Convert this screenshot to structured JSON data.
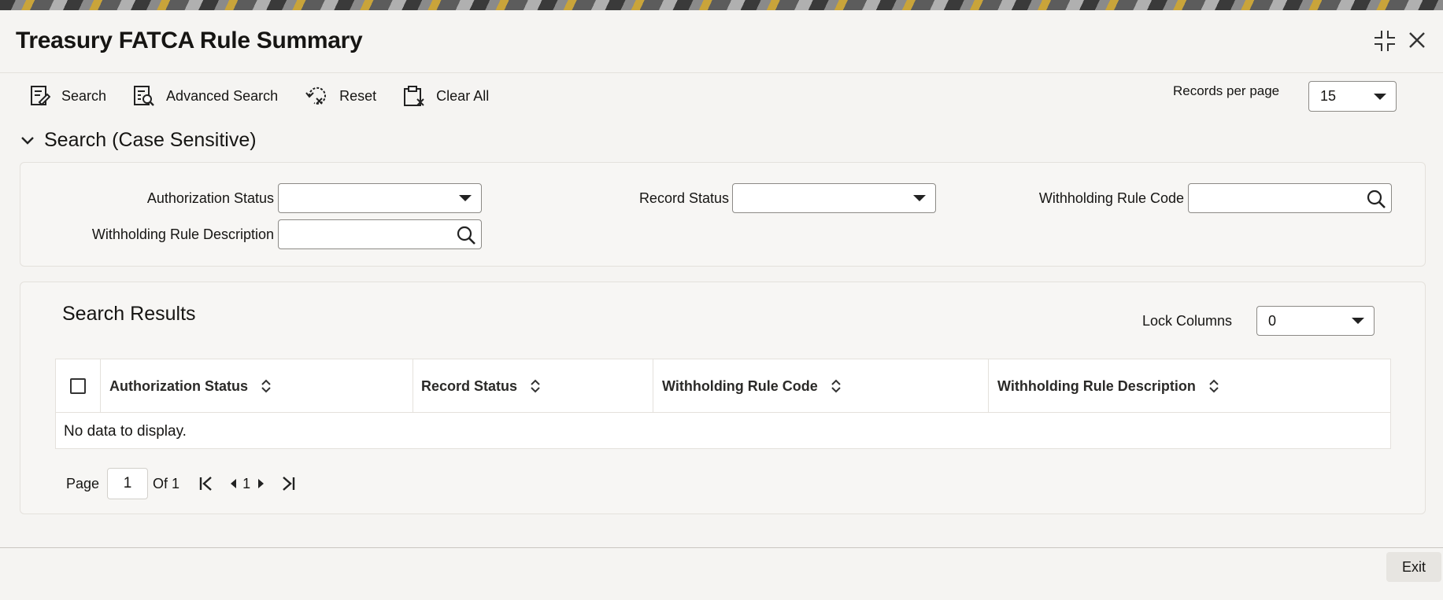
{
  "window": {
    "title": "Treasury FATCA Rule Summary"
  },
  "toolbar": {
    "search_label": "Search",
    "advanced_search_label": "Advanced Search",
    "reset_label": "Reset",
    "clear_all_label": "Clear All",
    "records_per_page_label": "Records per page",
    "records_per_page_value": "15"
  },
  "search_section": {
    "title": "Search (Case Sensitive)",
    "fields": {
      "authorization_status_label": "Authorization Status",
      "authorization_status_value": "",
      "record_status_label": "Record Status",
      "record_status_value": "",
      "withholding_rule_code_label": "Withholding Rule Code",
      "withholding_rule_code_value": "",
      "withholding_rule_description_label": "Withholding Rule Description",
      "withholding_rule_description_value": ""
    }
  },
  "results": {
    "title": "Search Results",
    "lock_columns_label": "Lock Columns",
    "lock_columns_value": "0",
    "columns": [
      "Authorization Status",
      "Record Status",
      "Withholding Rule Code",
      "Withholding Rule Description"
    ],
    "empty_message": "No data to display."
  },
  "pagination": {
    "page_label": "Page",
    "current_page": "1",
    "of_label": "Of 1",
    "page_number": "1"
  },
  "footer": {
    "exit_label": "Exit"
  }
}
